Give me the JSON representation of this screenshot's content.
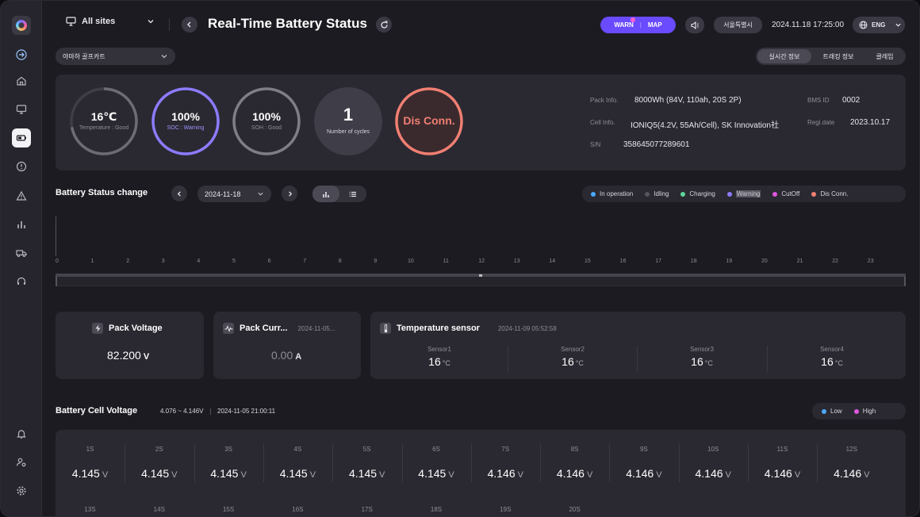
{
  "colors": {
    "accent": "#6b4bff",
    "soc_ring": "#8c7bff",
    "disconn_ring": "#f07f72",
    "in_operation": "#4aa8ff",
    "idling": "#55545e",
    "charging": "#5fd49b",
    "warning": "#8c7bff",
    "cutoff": "#e056e0",
    "dis_conn": "#f07f72",
    "low": "#4aa8ff",
    "high": "#e056e0"
  },
  "header": {
    "site_select": "All sites",
    "title": "Real-Time Battery Status",
    "warn_label": "WARN",
    "map_label": "MAP",
    "city": "서울특별시",
    "datetime": "2024.11.18 17:25:00",
    "language": "ENG"
  },
  "vehicle_select": "야마하 골프카트",
  "view_tabs": [
    "실시간 정보",
    "트래킹 정보",
    "클레임"
  ],
  "gauges": {
    "temperature": {
      "value": "16℃",
      "label": "Temperature : Good",
      "level": 0.72
    },
    "soc": {
      "value": "100%",
      "label": "SOC : Warning",
      "level": 1.0
    },
    "soh": {
      "value": "100%",
      "label": "SOH : Good",
      "level": 1.0
    },
    "cycles": {
      "value": "1",
      "label": "Number of cycles"
    },
    "status": {
      "value": "Dis Conn."
    }
  },
  "pack_info": {
    "pack_label": "Pack Info.",
    "pack_value": "8000Wh (84V, 110ah, 20S 2P)",
    "cell_label": "Cell Info.",
    "cell_value": "IONIQ5(4.2V, 55Ah/Cell), SK Innovation社",
    "sn_label": "S/N",
    "sn_value": "358645077289601",
    "bms_label": "BMS ID",
    "bms_value": "0002",
    "regi_label": "Regi.date",
    "regi_value": "2023.10.17"
  },
  "status_change": {
    "title": "Battery Status change",
    "date": "2024-11-18",
    "legend": [
      "In operation",
      "Idling",
      "Charging",
      "Warning",
      "CutOff",
      "Dis Conn."
    ],
    "hours": [
      "0",
      "1",
      "2",
      "3",
      "4",
      "5",
      "6",
      "7",
      "8",
      "9",
      "10",
      "11",
      "12",
      "13",
      "14",
      "15",
      "16",
      "17",
      "18",
      "19",
      "20",
      "21",
      "22",
      "23"
    ]
  },
  "pack_voltage": {
    "title": "Pack Voltage",
    "value": "82.200",
    "unit": "V"
  },
  "pack_current": {
    "title": "Pack Curr...",
    "timestamp": "2024-11-05...",
    "value": "0.00",
    "unit": "A"
  },
  "temperature_sensor": {
    "title": "Temperature sensor",
    "timestamp": "2024-11-09 05:52:58",
    "sensors": [
      {
        "name": "Sensor1",
        "value": "16",
        "unit": "°C"
      },
      {
        "name": "Sensor2",
        "value": "16",
        "unit": "°C"
      },
      {
        "name": "Sensor3",
        "value": "16",
        "unit": "°C"
      },
      {
        "name": "Sensor4",
        "value": "16",
        "unit": "°C"
      }
    ]
  },
  "cell_voltage": {
    "title": "Battery Cell Voltage",
    "range": "4.076 ~ 4.146V",
    "timestamp": "2024-11-05 21:00:11",
    "legend_low": "Low",
    "legend_high": "High",
    "unit": "V",
    "cells": [
      {
        "name": "1S",
        "value": "4.145"
      },
      {
        "name": "2S",
        "value": "4.145"
      },
      {
        "name": "3S",
        "value": "4.145"
      },
      {
        "name": "4S",
        "value": "4.145"
      },
      {
        "name": "5S",
        "value": "4.145"
      },
      {
        "name": "6S",
        "value": "4.145"
      },
      {
        "name": "7S",
        "value": "4.146"
      },
      {
        "name": "8S",
        "value": "4.146"
      },
      {
        "name": "9S",
        "value": "4.146"
      },
      {
        "name": "10S",
        "value": "4.146"
      },
      {
        "name": "11S",
        "value": "4.146"
      },
      {
        "name": "12S",
        "value": "4.146"
      }
    ],
    "cells_row2": [
      "13S",
      "14S",
      "15S",
      "16S",
      "17S",
      "18S",
      "19S",
      "20S"
    ]
  }
}
